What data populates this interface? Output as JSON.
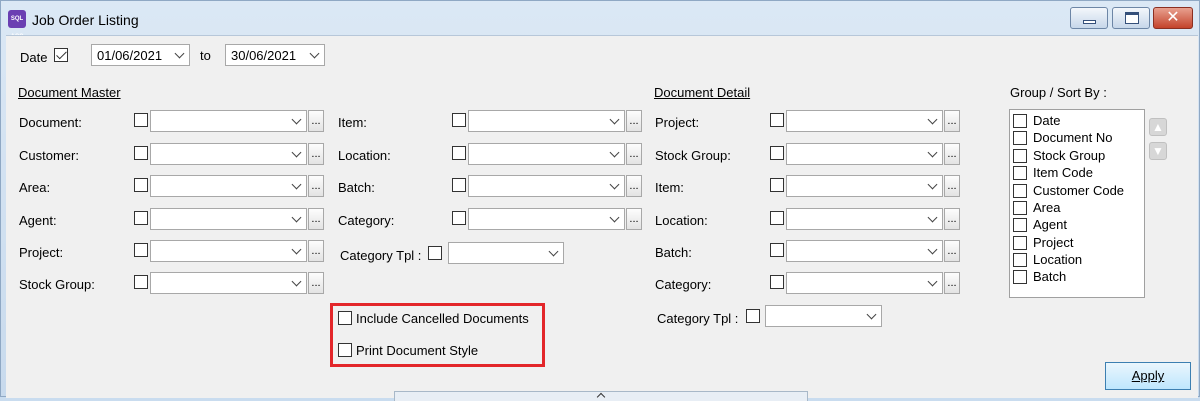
{
  "window": {
    "title": "Job Order Listing",
    "app_icon_text": "SQL ACC",
    "close_glyph": "✕"
  },
  "date": {
    "label": "Date",
    "checked": true,
    "from": "01/06/2021",
    "to_label": "to",
    "to": "30/06/2021"
  },
  "master": {
    "header": "Document Master",
    "col1": [
      "Document:",
      "Customer:",
      "Area:",
      "Agent:",
      "Project:",
      "Stock Group:"
    ],
    "col2": [
      "Item:",
      "Location:",
      "Batch:",
      "Category:"
    ],
    "category_tpl": "Category Tpl :"
  },
  "options": {
    "include_cancelled": "Include Cancelled Documents",
    "print_style": "Print Document Style"
  },
  "detail": {
    "header": "Document Detail",
    "fields": [
      "Project:",
      "Stock Group:",
      "Item:",
      "Location:",
      "Batch:",
      "Category:"
    ],
    "category_tpl": "Category Tpl :"
  },
  "group_sort": {
    "label": "Group / Sort By :",
    "items": [
      "Date",
      "Document No",
      "Stock Group",
      "Item Code",
      "Customer Code",
      "Area",
      "Agent",
      "Project",
      "Location",
      "Batch"
    ]
  },
  "buttons": {
    "ellipsis": "...",
    "apply": "Apply",
    "up_glyph": "▲",
    "down_glyph": "▼"
  },
  "colors": {
    "highlight": "#e3262a",
    "accent": "#3c7fb1"
  }
}
